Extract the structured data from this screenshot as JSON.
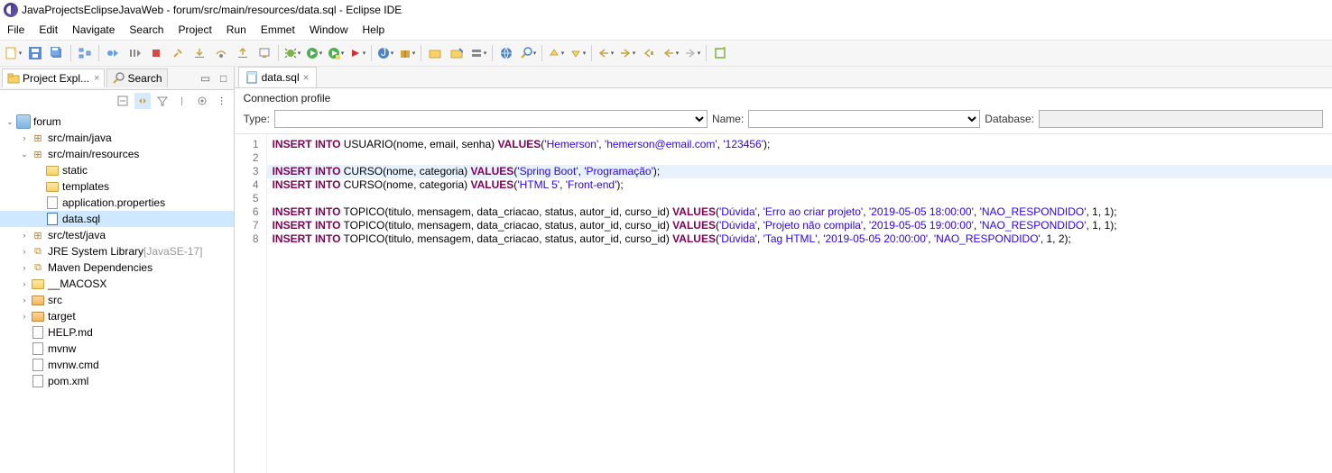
{
  "window": {
    "title": "JavaProjectsEclipseJavaWeb - forum/src/main/resources/data.sql - Eclipse IDE"
  },
  "menu": [
    "File",
    "Edit",
    "Navigate",
    "Search",
    "Project",
    "Run",
    "Emmet",
    "Window",
    "Help"
  ],
  "side_tabs": {
    "active": "Project Expl...",
    "inactive": "Search"
  },
  "tree": [
    {
      "d": 0,
      "a": "open",
      "i": "proj",
      "t": "forum"
    },
    {
      "d": 1,
      "a": "closed",
      "i": "pkg",
      "t": "src/main/java"
    },
    {
      "d": 1,
      "a": "open",
      "i": "pkg",
      "t": "src/main/resources"
    },
    {
      "d": 2,
      "a": "none",
      "i": "fold-y",
      "t": "static"
    },
    {
      "d": 2,
      "a": "none",
      "i": "fold-y",
      "t": "templates"
    },
    {
      "d": 2,
      "a": "none",
      "i": "file",
      "t": "application.properties"
    },
    {
      "d": 2,
      "a": "none",
      "i": "sql",
      "t": "data.sql",
      "sel": true
    },
    {
      "d": 1,
      "a": "closed",
      "i": "pkg",
      "t": "src/test/java"
    },
    {
      "d": 1,
      "a": "closed",
      "i": "lib",
      "t": "JRE System Library",
      "suffix": "[JavaSE-17]"
    },
    {
      "d": 1,
      "a": "closed",
      "i": "lib",
      "t": "Maven Dependencies"
    },
    {
      "d": 1,
      "a": "closed",
      "i": "fold-y",
      "t": "__MACOSX"
    },
    {
      "d": 1,
      "a": "closed",
      "i": "fold-o",
      "t": "src"
    },
    {
      "d": 1,
      "a": "closed",
      "i": "fold-o",
      "t": "target"
    },
    {
      "d": 1,
      "a": "none",
      "i": "file",
      "t": "HELP.md"
    },
    {
      "d": 1,
      "a": "none",
      "i": "file",
      "t": "mvnw"
    },
    {
      "d": 1,
      "a": "none",
      "i": "file",
      "t": "mvnw.cmd"
    },
    {
      "d": 1,
      "a": "none",
      "i": "file",
      "t": "pom.xml"
    }
  ],
  "editor_tab": "data.sql",
  "conn": {
    "header": "Connection profile",
    "type_label": "Type:",
    "name_label": "Name:",
    "db_label": "Database:"
  },
  "code": {
    "lines": [
      1,
      2,
      3,
      4,
      5,
      6,
      7,
      8
    ],
    "hl_line": 3,
    "l1": {
      "kw1": "INSERT",
      "kw2": "INTO",
      "tbl": "USUARIO",
      "cols": "(nome, email, senha)",
      "kw3": "VALUES",
      "s1": "'Hemerson'",
      "s2": "'hemerson@email.com'",
      "s3": "'123456'"
    },
    "l3": {
      "kw1": "INSERT",
      "kw2": "INTO",
      "tbl": "CURSO",
      "cols": "(nome, categoria)",
      "kw3": "VALUES",
      "s1": "'Spring Boot'",
      "s2": "'Programação'"
    },
    "l4": {
      "kw1": "INSERT",
      "kw2": "INTO",
      "tbl": "CURSO",
      "cols": "(nome, categoria)",
      "kw3": "VALUES",
      "s1": "'HTML 5'",
      "s2": "'Front-end'"
    },
    "l6": {
      "kw1": "INSERT",
      "kw2": "INTO",
      "tbl": "TOPICO",
      "cols": "(titulo, mensagem, data_criacao, status, autor_id, curso_id)",
      "kw3": "VALUES",
      "s1": "'Dúvida'",
      "s2": "'Erro ao criar projeto'",
      "s3": "'2019-05-05 18:00:00'",
      "s4": "'NAO_RESPONDIDO'",
      "n1": "1",
      "n2": "1"
    },
    "l7": {
      "kw1": "INSERT",
      "kw2": "INTO",
      "tbl": "TOPICO",
      "cols": "(titulo, mensagem, data_criacao, status, autor_id, curso_id)",
      "kw3": "VALUES",
      "s1": "'Dúvida'",
      "s2": "'Projeto não compila'",
      "s3": "'2019-05-05 19:00:00'",
      "s4": "'NAO_RESPONDIDO'",
      "n1": "1",
      "n2": "1"
    },
    "l8": {
      "kw1": "INSERT",
      "kw2": "INTO",
      "tbl": "TOPICO",
      "cols": "(titulo, mensagem, data_criacao, status, autor_id, curso_id)",
      "kw3": "VALUES",
      "s1": "'Dúvida'",
      "s2": "'Tag HTML'",
      "s3": "'2019-05-05 20:00:00'",
      "s4": "'NAO_RESPONDIDO'",
      "n1": "1",
      "n2": "2"
    }
  }
}
